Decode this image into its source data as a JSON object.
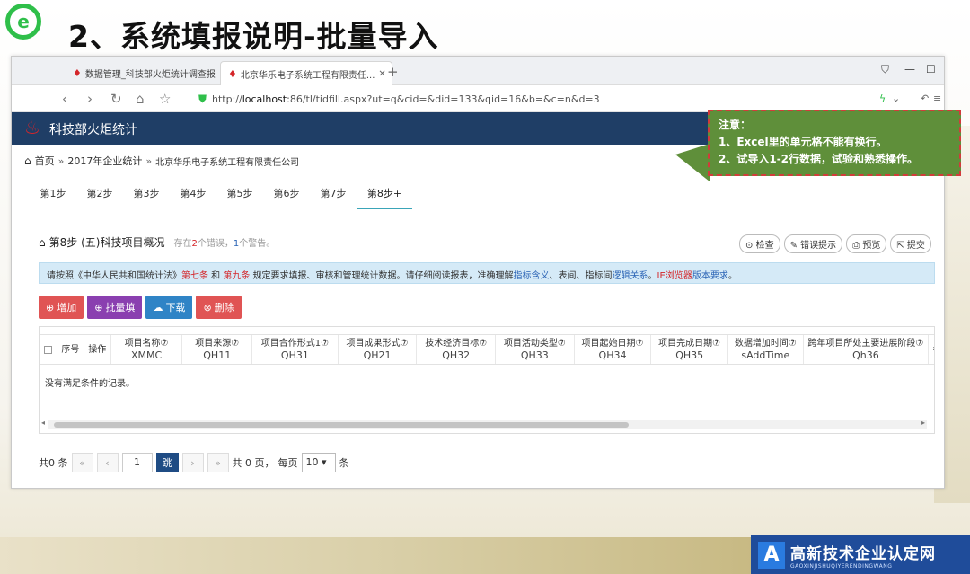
{
  "slide": {
    "title": "2、系统填报说明-批量导入"
  },
  "browser": {
    "tabs": [
      {
        "label": "数据管理_科技部火炬统计调查报"
      },
      {
        "label": "北京华乐电子系统工程有限责任..."
      }
    ],
    "new_tab": "+",
    "address": {
      "prefix": "http://",
      "host": "localhost",
      "rest": ":86/tl/tidfill.aspx?ut=q&cid=&did=133&qid=16&b=&c=n&d=3"
    }
  },
  "app": {
    "title": "科技部火炬统计",
    "breadcrumb": {
      "home": "首页",
      "sep": "»",
      "level1": "2017年企业统计",
      "level2": "北京华乐电子系统工程有限责任公司"
    },
    "steps": [
      "第1步",
      "第2步",
      "第3步",
      "第4步",
      "第5步",
      "第6步",
      "第7步",
      "第8步+"
    ],
    "section": {
      "title": "第8步 (五)科技项目概况",
      "status_prefix": "存在",
      "error_count": "2",
      "status_mid": "个错误，",
      "warn_count": "1",
      "status_suffix": "个警告。"
    },
    "toolbar": {
      "check": "检查",
      "error_msg": "错误提示",
      "preview": "预览",
      "submit": "提交"
    },
    "notice": {
      "p1": "请按照《中华人民共和国统计法》",
      "red1": "第七条",
      "p2": " 和 ",
      "red2": "第九条",
      "p3": " 规定要求填报、审核和管理统计数据。请仔细阅读报表，准确理解",
      "blue1": "指标含义",
      "p4": "、表间、指标间",
      "blue2": "逻辑关系",
      "p5": "。",
      "red3": "IE浏览器",
      "blue3": "版本要求",
      "p6": "。"
    },
    "actions": {
      "add": "增加",
      "batch": "批量填",
      "download": "下载",
      "delete": "删除"
    },
    "table": {
      "headers": [
        {
          "label": "序号",
          "code": ""
        },
        {
          "label": "操作",
          "code": ""
        },
        {
          "label": "项目名称⑦",
          "code": "XMMC"
        },
        {
          "label": "项目来源⑦",
          "code": "QH11"
        },
        {
          "label": "项目合作形式1⑦",
          "code": "QH31"
        },
        {
          "label": "项目成果形式⑦",
          "code": "QH21"
        },
        {
          "label": "技术经济目标⑦",
          "code": "QH32"
        },
        {
          "label": "项目活动类型⑦",
          "code": "QH33"
        },
        {
          "label": "项目起始日期⑦",
          "code": "QH34"
        },
        {
          "label": "项目完成日期⑦",
          "code": "QH35"
        },
        {
          "label": "数据增加时间⑦",
          "code": "sAddTime"
        },
        {
          "label": "跨年项目所处主要进展阶段⑦",
          "code": "Qh36"
        },
        {
          "label": "参加",
          "code": ""
        }
      ],
      "empty_text": "没有满足条件的记录。"
    },
    "pager": {
      "total_prefix": "共",
      "total_count": "0",
      "total_suffix": "条",
      "first": "«",
      "prev": "‹",
      "page": "1",
      "go": "跳",
      "next": "›",
      "last": "»",
      "pages_text": "共 0 页，",
      "per_page_label": "每页",
      "per_page_value": "10",
      "per_page_suffix": "条"
    }
  },
  "callout": {
    "title": "注意：",
    "line1": "1、Excel里的单元格不能有换行。",
    "line2": "2、试导入1-2行数据，试验和熟悉操作。"
  },
  "watermark": {
    "letter": "A",
    "name": "高新技术企业认定网",
    "pinyin": "GAOXINJISHUQIYERENDINGWANG"
  },
  "colors": {
    "app_header": "#1f3e66",
    "accent_green": "#2fbf4a",
    "callout_bg": "#5f8f3a",
    "callout_border": "#d23b3b"
  }
}
